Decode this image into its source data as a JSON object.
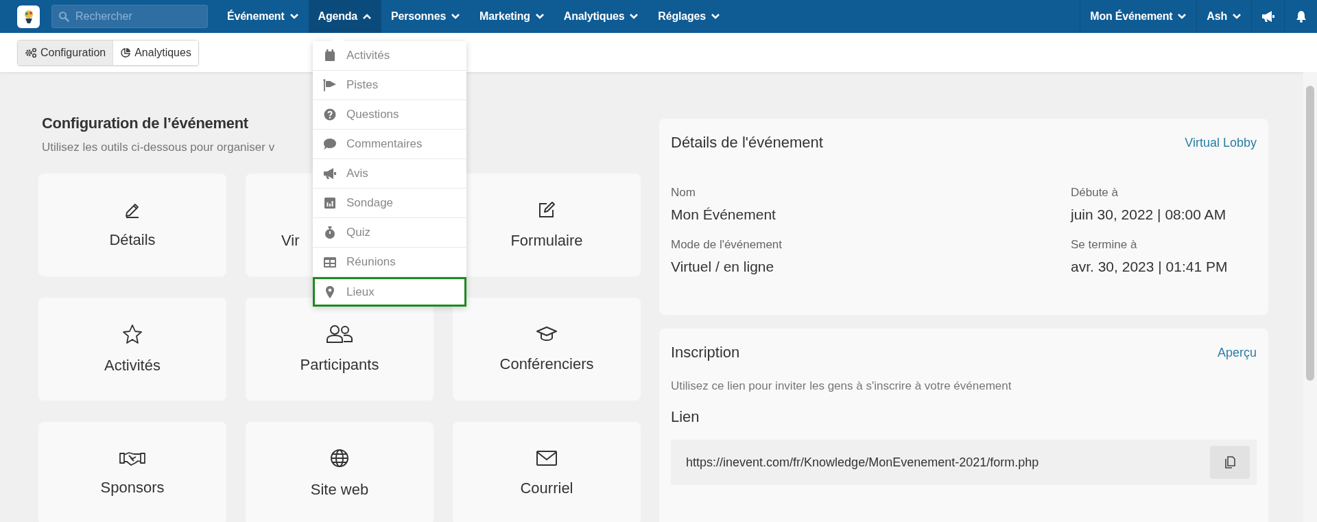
{
  "topbar": {
    "search": {
      "placeholder": "Rechercher"
    },
    "nav": [
      {
        "label": "Événement",
        "selected": false
      },
      {
        "label": "Agenda",
        "selected": true
      },
      {
        "label": "Personnes",
        "selected": false
      },
      {
        "label": "Marketing",
        "selected": false
      },
      {
        "label": "Analytiques",
        "selected": false
      },
      {
        "label": "Réglages",
        "selected": false
      }
    ],
    "event_menu": "Mon Événement",
    "user_menu": "Ash"
  },
  "toolbar": {
    "tabs": [
      {
        "label": "Configuration",
        "kind": "gears",
        "selected": true
      },
      {
        "label": "Analytiques",
        "kind": "chart",
        "selected": false
      }
    ]
  },
  "agenda_menu": [
    {
      "label": "Activités",
      "kind": "calendar",
      "selected": false
    },
    {
      "label": "Pistes",
      "kind": "flag",
      "selected": false
    },
    {
      "label": "Questions",
      "kind": "question",
      "selected": false
    },
    {
      "label": "Commentaires",
      "kind": "comment",
      "selected": false
    },
    {
      "label": "Avis",
      "kind": "megaphone",
      "selected": false
    },
    {
      "label": "Sondage",
      "kind": "poll",
      "selected": false
    },
    {
      "label": "Quiz",
      "kind": "stopwatch",
      "selected": false
    },
    {
      "label": "Réunions",
      "kind": "table",
      "selected": false
    },
    {
      "label": "Lieux",
      "kind": "pin",
      "selected": true
    }
  ],
  "configuration": {
    "title": "Configuration de l’événement",
    "subtitle": "Utilisez les outils ci-dessous pour organiser v",
    "tiles": [
      {
        "label": "Détails",
        "kind": "pencil"
      },
      {
        "label": "Vir",
        "kind": "hidden"
      },
      {
        "label": "Formulaire",
        "kind": "edit"
      },
      {
        "label": "Activités",
        "kind": "star"
      },
      {
        "label": "Participants",
        "kind": "people"
      },
      {
        "label": "Conférenciers",
        "kind": "cap"
      },
      {
        "label": "Sponsors",
        "kind": "handshake"
      },
      {
        "label": "Site web",
        "kind": "globe"
      },
      {
        "label": "Courriel",
        "kind": "mail"
      }
    ]
  },
  "event_details": {
    "title": "Détails de l'événement",
    "link": "Virtual Lobby",
    "fields": [
      {
        "label": "Nom",
        "value": "Mon Événement"
      },
      {
        "label": "Débute à",
        "value": "juin 30, 2022 | 08:00 AM"
      },
      {
        "label": "Mode de l'événement",
        "value": "Virtuel / en ligne"
      },
      {
        "label": "Se termine à",
        "value": "avr. 30, 2023 | 01:41 PM"
      }
    ]
  },
  "registration": {
    "title": "Inscription",
    "link": "Aperçu",
    "description": "Utilisez ce lien pour inviter les gens à s'inscrire à votre événement",
    "link_label": "Lien",
    "url": "https://inevent.com/fr/Knowledge/MonEvenement-2021/form.php"
  }
}
